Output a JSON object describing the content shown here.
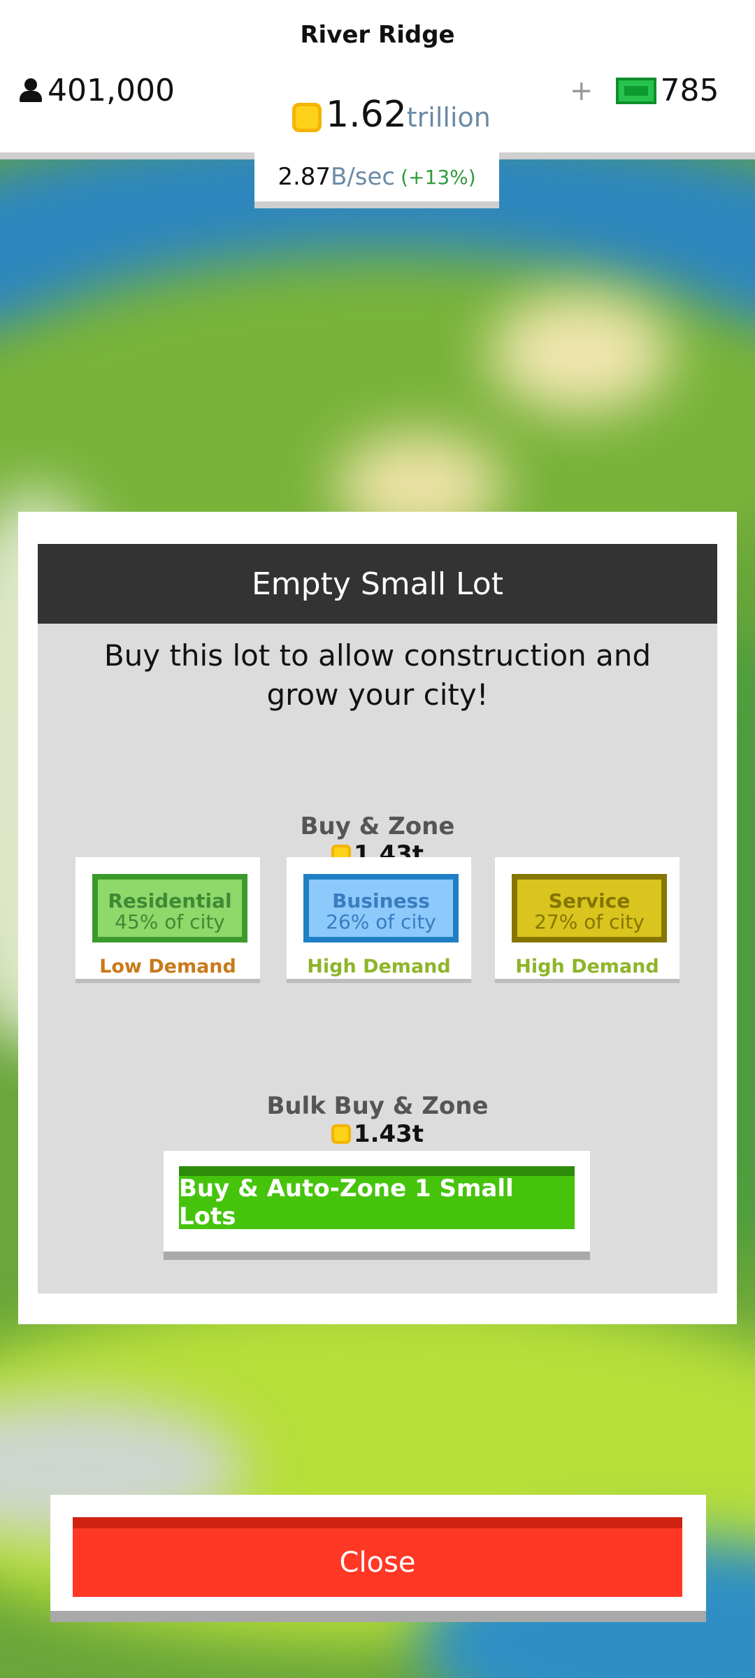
{
  "hud": {
    "city_name": "River Ridge",
    "population": "401,000",
    "coins_value": "1.62",
    "coins_unit": "trillion",
    "cash_plus": "+",
    "cash_value": "785",
    "rate_value": "2.87",
    "rate_unit": "B/sec",
    "rate_change": "(+13%)"
  },
  "modal": {
    "title": "Empty Small Lot",
    "description": "Buy this lot to allow construction and grow your city!",
    "buy_zone": {
      "label": "Buy & Zone",
      "price": "1.43t",
      "zones": [
        {
          "name": "Residential",
          "share": "45% of city",
          "demand": "Low Demand",
          "demand_color": "#c97a1a"
        },
        {
          "name": "Business",
          "share": "26% of city",
          "demand": "High Demand",
          "demand_color": "#8db52a"
        },
        {
          "name": "Service",
          "share": "27% of city",
          "demand": "High Demand",
          "demand_color": "#8db52a"
        }
      ]
    },
    "bulk": {
      "label": "Bulk Buy & Zone",
      "price": "1.43t",
      "button_label": "Buy & Auto-Zone 1 Small Lots"
    }
  },
  "close_label": "Close",
  "colors": {
    "coin": "#ffd21a",
    "bulk_button": "#46c40c",
    "close_button": "#ff3826",
    "header": "#333333"
  }
}
